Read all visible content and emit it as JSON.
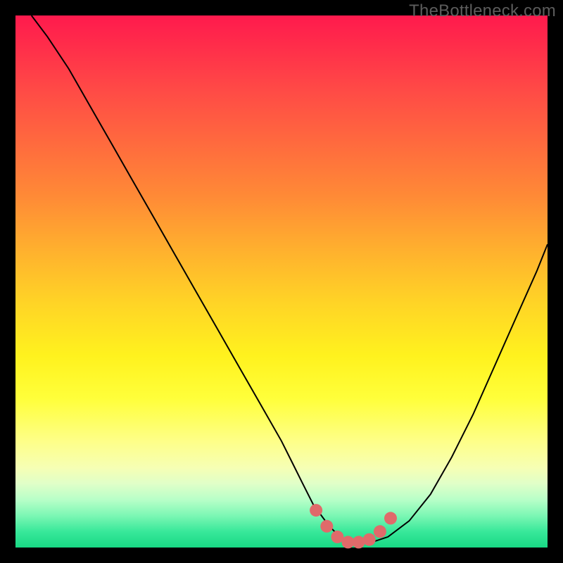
{
  "watermark": "TheBottleneck.com",
  "chart_data": {
    "type": "line",
    "title": "",
    "xlabel": "",
    "ylabel": "",
    "xlim": [
      0,
      100
    ],
    "ylim": [
      0,
      100
    ],
    "series": [
      {
        "name": "bottleneck-curve",
        "x": [
          3,
          6,
          10,
          14,
          18,
          22,
          26,
          30,
          34,
          38,
          42,
          46,
          50,
          52,
          54,
          56,
          59,
          61,
          63,
          65,
          67,
          70,
          74,
          78,
          82,
          86,
          90,
          94,
          98,
          100
        ],
        "y": [
          100,
          96,
          90,
          83,
          76,
          69,
          62,
          55,
          48,
          41,
          34,
          27,
          20,
          16,
          12,
          8,
          4,
          2,
          1,
          1,
          1,
          2,
          5,
          10,
          17,
          25,
          34,
          43,
          52,
          57
        ],
        "color": "#000000",
        "stroke_width": 2
      }
    ],
    "markers": {
      "name": "highlight-dots",
      "color": "#e06a6a",
      "radius": 9,
      "points_x": [
        56.5,
        58.5,
        60.5,
        62.5,
        64.5,
        66.5,
        68.5,
        70.5
      ],
      "points_y": [
        7.0,
        4.0,
        2.0,
        1.0,
        1.0,
        1.5,
        3.0,
        5.5
      ]
    }
  }
}
